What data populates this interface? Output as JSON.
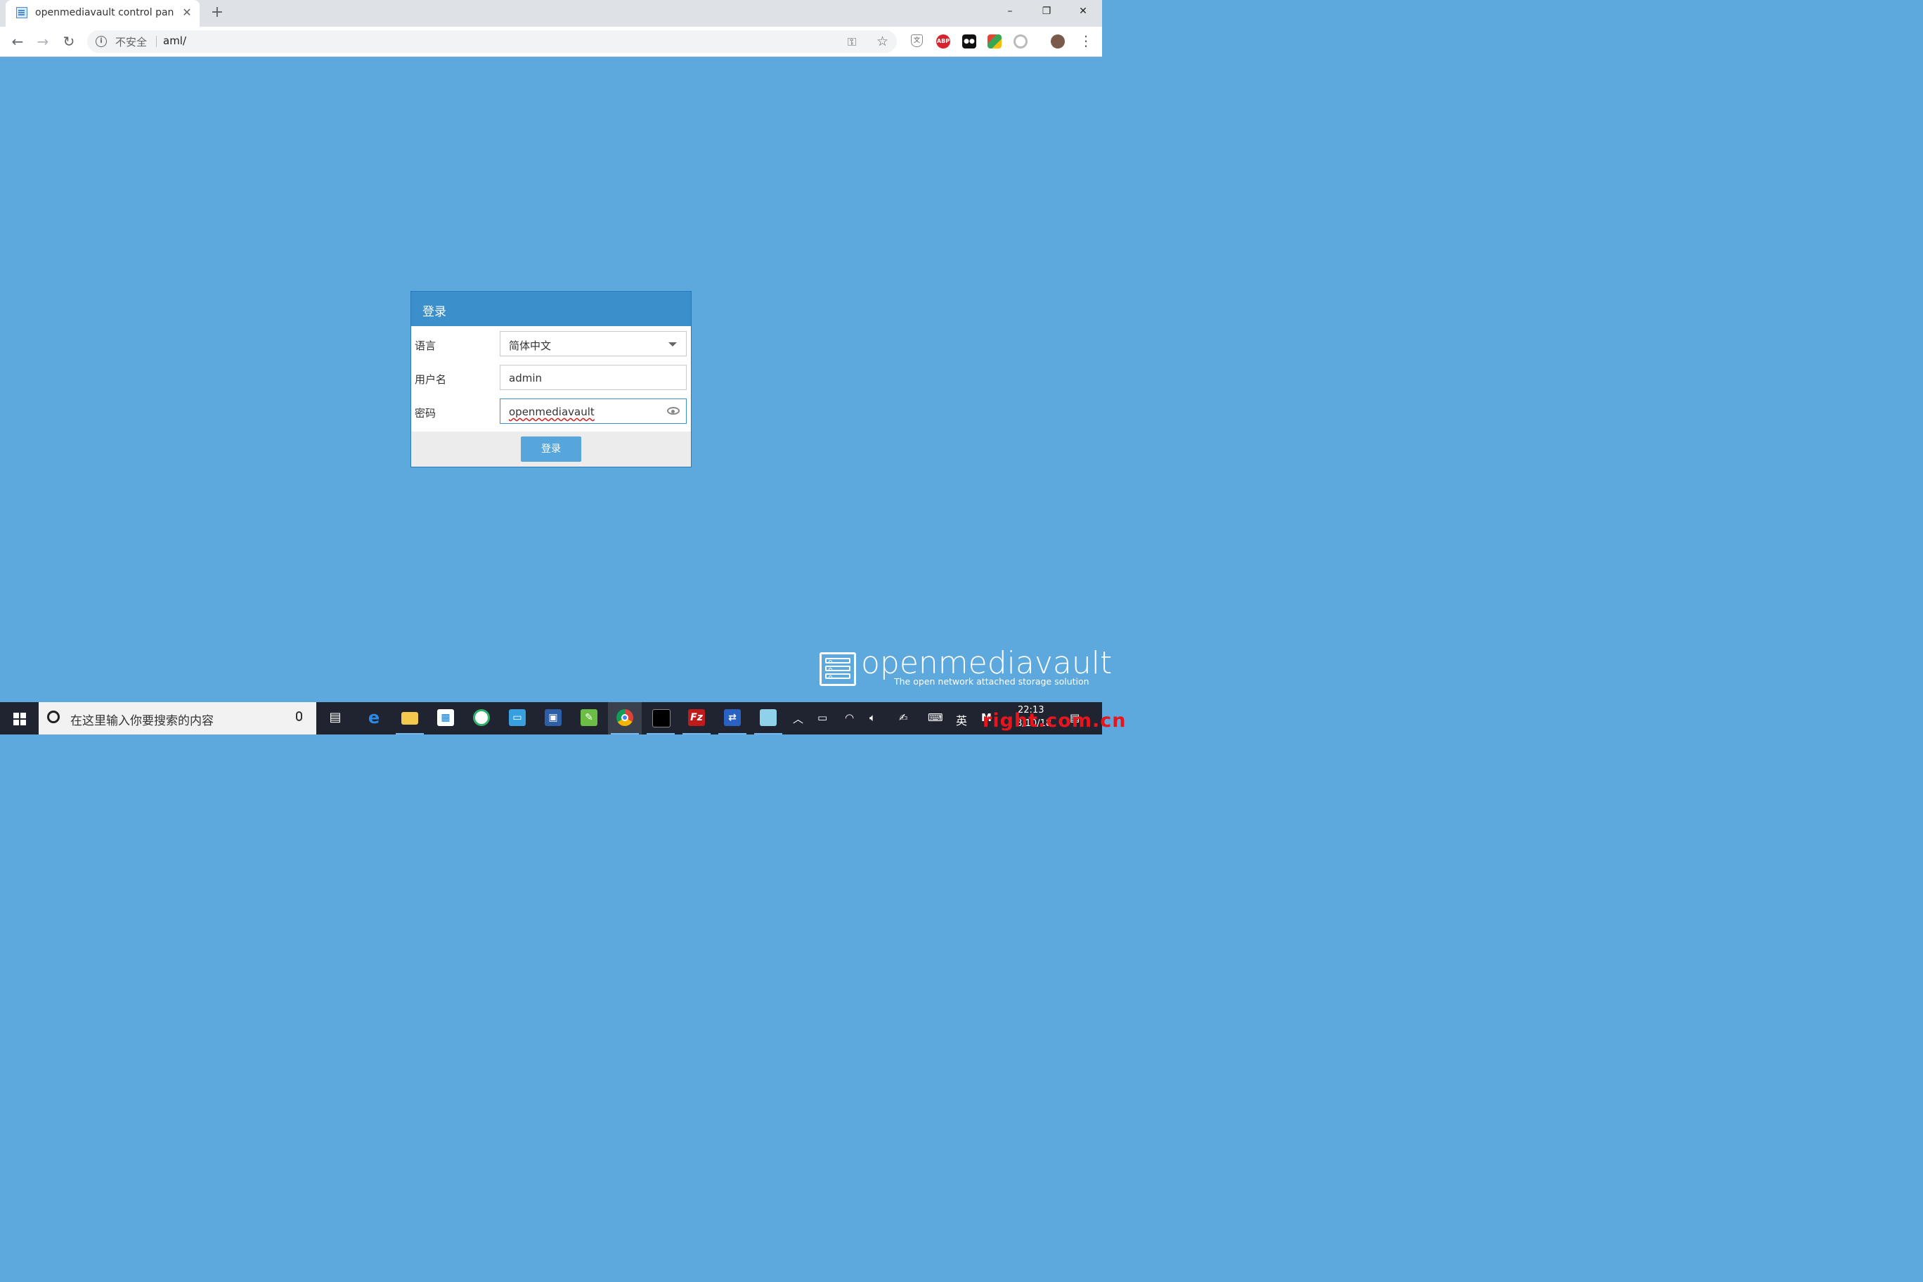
{
  "browser": {
    "tab_title": "openmediavault control panel",
    "security_label": "不安全",
    "url": "aml/",
    "win_controls": [
      "–",
      "❐",
      "✕"
    ]
  },
  "login": {
    "title": "登录",
    "language_label": "语言",
    "language_value": "简体中文",
    "username_label": "用户名",
    "username_value": "admin",
    "password_label": "密码",
    "password_value": "openmediavault",
    "submit_label": "登录"
  },
  "brand": {
    "name": "openmediavault",
    "tagline": "The open network attached storage solution"
  },
  "taskbar": {
    "search_placeholder": "在这里输入你要搜索的内容",
    "ime_label": "英",
    "time": "22:13",
    "date": "8/10/18"
  },
  "watermark": "right.com.cn",
  "colors": {
    "background": "#5da9dd",
    "panel_header": "#3b8fcb",
    "button": "#56a6db"
  }
}
